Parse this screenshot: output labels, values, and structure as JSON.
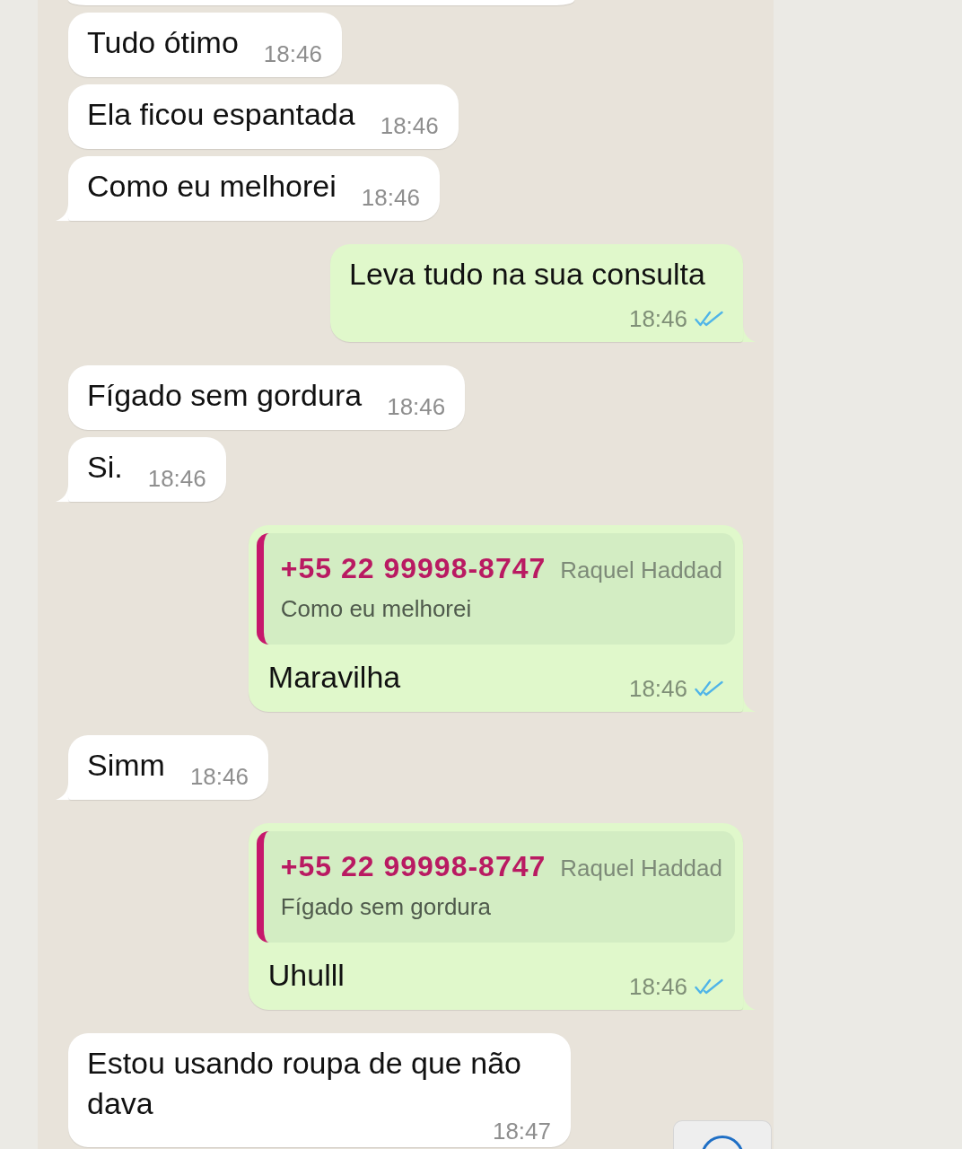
{
  "chat": {
    "messages": [
      {
        "kind": "received",
        "text": "Tudo ótimo",
        "time": "18:46",
        "tail": false
      },
      {
        "kind": "received",
        "text": "Ela ficou espantada",
        "time": "18:46",
        "tail": false
      },
      {
        "kind": "received",
        "text": "Como eu melhorei",
        "time": "18:46",
        "tail": true
      },
      {
        "kind": "sent",
        "text": "Leva tudo na sua consulta",
        "time": "18:46",
        "read": true,
        "tail": true
      },
      {
        "kind": "received",
        "text": "Fígado sem gordura",
        "time": "18:46",
        "tail": false
      },
      {
        "kind": "received",
        "text": "Si.",
        "time": "18:46",
        "tail": true
      },
      {
        "kind": "sent",
        "quote": {
          "phone": "+55 22 99998-8747",
          "push_name": "Raquel Haddad",
          "text": "Como eu melhorei"
        },
        "text": "Maravilha",
        "time": "18:46",
        "read": true,
        "tail": true
      },
      {
        "kind": "received",
        "text": "Simm",
        "time": "18:46",
        "tail": true
      },
      {
        "kind": "sent",
        "quote": {
          "phone": "+55 22 99998-8747",
          "push_name": "Raquel Haddad",
          "text": "Fígado sem gordura"
        },
        "text": "Uhulll",
        "time": "18:46",
        "read": true,
        "tail": true
      },
      {
        "kind": "received",
        "text": "Estou usando roupa de que não dava",
        "time": "18:47",
        "tail": false
      }
    ]
  }
}
